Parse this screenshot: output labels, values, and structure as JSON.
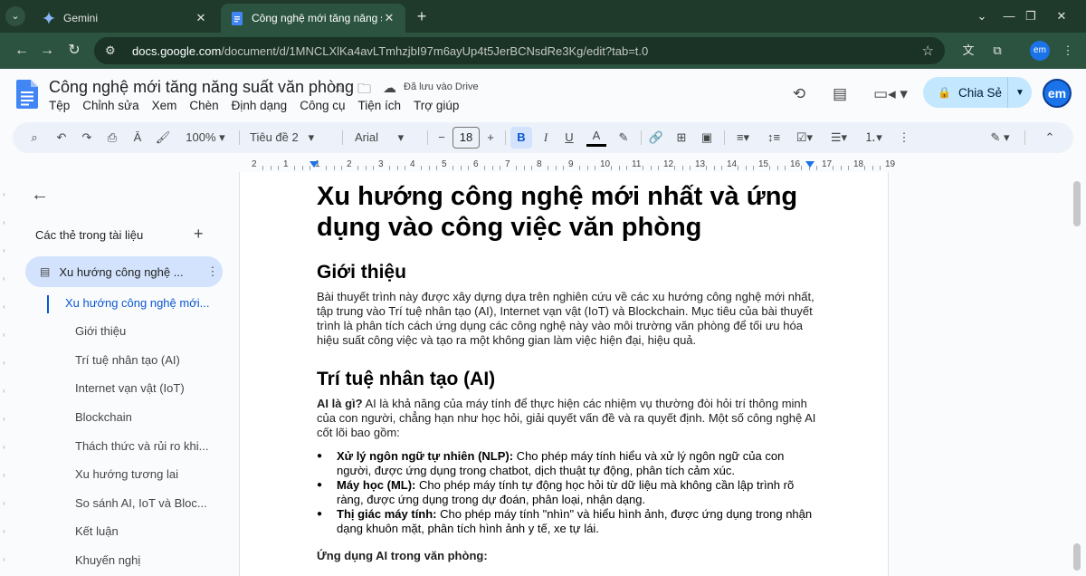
{
  "browser": {
    "tabs": [
      {
        "title": "Gemini",
        "icon": "gemini-icon"
      },
      {
        "title": "Công nghệ mới tăng năng suất",
        "icon": "docs-icon"
      }
    ],
    "url_host": "docs.google.com",
    "url_path": "/document/d/1MNCLXlKa4avLTmhzjbI97m6ayUp4t5JerBCNsdRe3Kg/edit?tab=t.0",
    "profile_initials": "em"
  },
  "docs": {
    "title": "Công nghệ mới tăng năng suất văn phòng",
    "saved_status": "Đã lưu vào Drive",
    "menu": [
      "Tệp",
      "Chỉnh sửa",
      "Xem",
      "Chèn",
      "Định dạng",
      "Công cụ",
      "Tiện ích",
      "Trợ giúp"
    ],
    "share_label": "Chia Sẻ",
    "avatar_initials": "em"
  },
  "toolbar": {
    "zoom": "100%",
    "style": "Tiêu đề 2",
    "font": "Arial",
    "font_size": "18"
  },
  "ruler": {
    "ticks": [
      "2",
      "1",
      "1",
      "2",
      "3",
      "4",
      "5",
      "6",
      "7",
      "8",
      "9",
      "10",
      "11",
      "12",
      "13",
      "14",
      "15",
      "16",
      "17",
      "18",
      "19"
    ]
  },
  "sidebar": {
    "section_title": "Các thẻ trong tài liệu",
    "tab_label": "Xu hướng công nghệ ...",
    "outline": [
      "Xu hướng công nghệ mới...",
      "Giới thiệu",
      "Trí tuệ nhân tạo (AI)",
      "Internet vạn vật (IoT)",
      "Blockchain",
      "Thách thức và rủi ro khi...",
      "Xu hướng tương lai",
      "So sánh AI, IoT và Bloc...",
      "Kết luận",
      "Khuyến nghị"
    ]
  },
  "document": {
    "h1": "Xu hướng công nghệ mới nhất và ứng dụng vào công việc văn phòng",
    "intro_heading": "Giới thiệu",
    "intro_text": "Bài thuyết trình này được xây dựng dựa trên nghiên cứu về các xu hướng công nghệ mới nhất, tập trung vào Trí tuệ nhân tạo (AI), Internet vạn vật (IoT) và Blockchain. Mục tiêu của bài thuyết trình là phân tích cách ứng dụng các công nghệ này vào môi trường văn phòng để tối ưu hóa hiệu suất công việc và tạo ra một không gian làm việc hiện đại, hiệu quả.",
    "ai_heading": "Trí tuệ nhân tạo (AI)",
    "ai_q": "AI là gì?",
    "ai_def": " AI là khả năng của máy tính để thực hiện các nhiệm vụ thường đòi hỏi trí thông minh của con người, chẳng hạn như học hỏi, giải quyết vấn đề và ra quyết định. Một số công nghệ AI cốt lõi bao gồm:",
    "bullets": [
      {
        "term": "Xử lý ngôn ngữ tự nhiên (NLP):",
        "text": " Cho phép máy tính hiểu và xử lý ngôn ngữ của con người, được ứng dụng trong chatbot, dịch thuật tự động, phân tích cảm xúc."
      },
      {
        "term": "Máy học (ML):",
        "text": " Cho phép máy tính tự động học hỏi từ dữ liệu mà không cần lập trình rõ ràng, được ứng dụng trong dự đoán, phân loại, nhận dạng."
      },
      {
        "term": "Thị giác máy tính:",
        "text": " Cho phép máy tính \"nhìn\" và hiểu hình ảnh, được ứng dụng trong nhận dạng khuôn mặt, phân tích hình ảnh y tế, xe tự lái."
      }
    ],
    "office_heading": "Ứng dụng AI trong văn phòng:"
  }
}
